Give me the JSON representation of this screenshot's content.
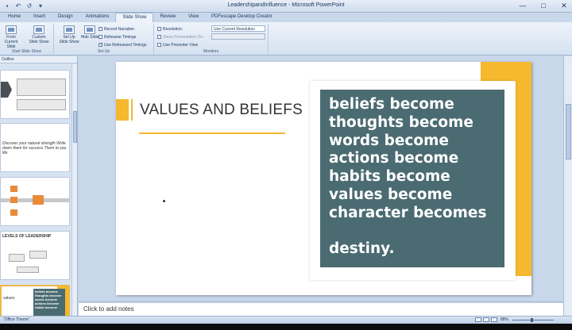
{
  "window": {
    "title": "LeadershipandInfluence - Microsoft PowerPoint",
    "controls": [
      "—",
      "□",
      "✕"
    ]
  },
  "tabs": [
    "Home",
    "Insert",
    "Design",
    "Animations",
    "Slide Show",
    "Review",
    "View",
    "PDFescape Desktop Creator"
  ],
  "active_tab": "Slide Show",
  "ribbon": {
    "from_current_label": "From Current Slide",
    "custom_show_label": "Custom Slide Show",
    "setup_show_label": "Set Up Slide Show",
    "hide_slide_label": "Hide Slide",
    "record_narration": "Record Narration",
    "rehearse_timings": "Rehearse Timings",
    "use_rehearsed": "Use Rehearsed Timings",
    "resolution_label": "Resolution:",
    "resolution_value": "Use Current Resolution",
    "show_on_label": "Show Presentation On:",
    "presenter_view": "Use Presenter View",
    "group_start": "Start Slide Show",
    "group_setup": "Set Up",
    "group_monitors": "Monitors"
  },
  "left_panel": {
    "header": "Outline",
    "thumb2_text": "Discover your natural strength Write down them for success Them to you life",
    "thumb4_title": "LEVELS OF LEADERSHIP",
    "thumb5_left": "values",
    "thumb5_right": "beliefs become thoughts become words become actions become habits become"
  },
  "slide": {
    "title": "VALUES AND BELIEFS",
    "quote_lines": [
      "beliefs become",
      "thoughts become",
      "words become",
      "actions become",
      "habits become",
      "values become",
      "character becomes"
    ],
    "quote_end": "destiny."
  },
  "notes": {
    "placeholder": "Click to add notes"
  },
  "status": {
    "theme": "\"Office Theme\"",
    "zoom": "88%"
  },
  "colors": {
    "accent_yellow": "#f5b82e",
    "quote_teal": "#4a6b71"
  }
}
